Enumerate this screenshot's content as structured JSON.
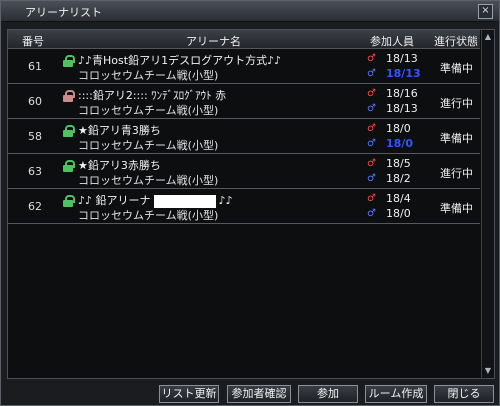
{
  "window": {
    "title": "アリーナリスト",
    "close_label": "×"
  },
  "columns": {
    "num": "番号",
    "name": "アリーナ名",
    "players": "参加人員",
    "status": "進行状態"
  },
  "rows": [
    {
      "num": "61",
      "locked": false,
      "line1": "♪♪青Host鉛アリ1デスログアウト方式♪♪",
      "line2": "コロッセウムチーム戦(小型)",
      "c1": "18/13",
      "c2": "18/13",
      "c2_highlight": true,
      "status": "準備中"
    },
    {
      "num": "60",
      "locked": true,
      "line1": "::::鉛アリ2:::: ﾜﾝﾃﾞｽﾛｸﾞｱｳﾄ 赤",
      "line2": "コロッセウムチーム戦(小型)",
      "c1": "18/16",
      "c2": "18/13",
      "c2_highlight": false,
      "status": "進行中"
    },
    {
      "num": "58",
      "locked": false,
      "line1": "★鉛アリ青3勝ち",
      "line2": "コロッセウムチーム戦(小型)",
      "c1": "18/0",
      "c2": "18/0",
      "c2_highlight": true,
      "status": "準備中"
    },
    {
      "num": "63",
      "locked": false,
      "line1": "★鉛アリ3赤勝ち",
      "line2": "コロッセウムチーム戦(小型)",
      "c1": "18/5",
      "c2": "18/2",
      "c2_highlight": false,
      "status": "進行中"
    },
    {
      "num": "62",
      "locked": false,
      "line1_prefix": "♪♪ 鉛アリーナ",
      "line1_suffix": "♪♪",
      "line2": "コロッセウムチーム戦(小型)",
      "c1": "18/4",
      "c2": "18/0",
      "c2_highlight": false,
      "status": "準備中"
    }
  ],
  "symbols": {
    "red": "♂",
    "blue": "♂"
  },
  "buttons": {
    "refresh": "リスト更新",
    "confirm": "参加者確認",
    "join": "参加",
    "create": "ルーム作成",
    "close": "閉じる"
  },
  "colors": {
    "locked": "#c98b8b",
    "unlocked": "#4ec25f"
  }
}
